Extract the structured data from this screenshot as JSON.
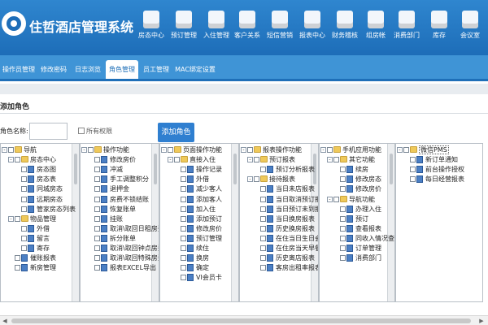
{
  "header": {
    "app_title": "住哲酒店管理系统",
    "nav": [
      {
        "label": "房态中心",
        "icon": "house-icon"
      },
      {
        "label": "预订管理",
        "icon": "booking-calendar-icon"
      },
      {
        "label": "入住管理",
        "icon": "checkin-door-icon"
      },
      {
        "label": "客户关系",
        "icon": "customers-icon"
      },
      {
        "label": "短信营销",
        "icon": "sms-envelope-icon"
      },
      {
        "label": "报表中心",
        "icon": "report-chart-icon"
      },
      {
        "label": "财务稽核",
        "icon": "finance-audit-icon"
      },
      {
        "label": "组房帐",
        "icon": "group-ledger-icon"
      },
      {
        "label": "消费部门",
        "icon": "consumption-dept-icon"
      },
      {
        "label": "库存",
        "icon": "inventory-icon"
      },
      {
        "label": "会议室",
        "icon": "meeting-room-icon"
      }
    ]
  },
  "tabs": [
    {
      "label": "操作员管理"
    },
    {
      "label": "修改密码"
    },
    {
      "label": "日志浏览"
    },
    {
      "label": "角色管理",
      "active": true
    },
    {
      "label": "员工管理"
    },
    {
      "label": "MAC绑定设置"
    }
  ],
  "page": {
    "title": "添加角色",
    "role_name_label": "角色名称:",
    "role_name_value": "",
    "all_perms_label": "所有权限",
    "add_button": "添加角色"
  },
  "trees": [
    {
      "name": "导航",
      "nodes": [
        {
          "label": "导航",
          "lv": 0,
          "type": "folder",
          "pm": "-"
        },
        {
          "label": "房态中心",
          "lv": 1,
          "type": "folder",
          "pm": "-"
        },
        {
          "label": "房态图",
          "lv": 2,
          "type": "leaf"
        },
        {
          "label": "房态表",
          "lv": 2,
          "type": "leaf"
        },
        {
          "label": "同城房态",
          "lv": 2,
          "type": "leaf"
        },
        {
          "label": "远期房态",
          "lv": 2,
          "type": "leaf"
        },
        {
          "label": "管家房态列表",
          "lv": 2,
          "type": "leaf"
        },
        {
          "label": "物品管理",
          "lv": 1,
          "type": "folder",
          "pm": "-"
        },
        {
          "label": "外借",
          "lv": 2,
          "type": "leaf"
        },
        {
          "label": "留言",
          "lv": 2,
          "type": "leaf"
        },
        {
          "label": "寄存",
          "lv": 2,
          "type": "leaf"
        },
        {
          "label": "催账报表",
          "lv": 1,
          "type": "leaf"
        },
        {
          "label": "新房管理",
          "lv": 1,
          "type": "leaf"
        }
      ]
    },
    {
      "name": "操作功能",
      "nodes": [
        {
          "label": "操作功能",
          "lv": 0,
          "type": "folder",
          "pm": "-"
        },
        {
          "label": "修改房价",
          "lv": 1,
          "type": "leaf"
        },
        {
          "label": "冲减",
          "lv": 1,
          "type": "leaf"
        },
        {
          "label": "手工调整积分",
          "lv": 1,
          "type": "leaf"
        },
        {
          "label": "退押金",
          "lv": 1,
          "type": "leaf"
        },
        {
          "label": "房费不锁结账",
          "lv": 1,
          "type": "leaf"
        },
        {
          "label": "恢复账单",
          "lv": 1,
          "type": "leaf"
        },
        {
          "label": "挂账",
          "lv": 1,
          "type": "leaf"
        },
        {
          "label": "取消\\取回日租房费",
          "lv": 1,
          "type": "leaf"
        },
        {
          "label": "拆分账单",
          "lv": 1,
          "type": "leaf"
        },
        {
          "label": "取消\\取回钟点房费",
          "lv": 1,
          "type": "leaf"
        },
        {
          "label": "取消\\取回特殊房费",
          "lv": 1,
          "type": "leaf"
        },
        {
          "label": "报表EXCEL导出",
          "lv": 1,
          "type": "leaf"
        }
      ]
    },
    {
      "name": "页面操作功能",
      "nodes": [
        {
          "label": "页面操作功能",
          "lv": 0,
          "type": "folder",
          "pm": "-"
        },
        {
          "label": "直接入住",
          "lv": 1,
          "type": "folder",
          "pm": "-"
        },
        {
          "label": "操作记录",
          "lv": 2,
          "type": "leaf"
        },
        {
          "label": "外借",
          "lv": 2,
          "type": "leaf"
        },
        {
          "label": "减少客人",
          "lv": 2,
          "type": "leaf"
        },
        {
          "label": "添加客人",
          "lv": 2,
          "type": "leaf"
        },
        {
          "label": "加入住",
          "lv": 2,
          "type": "leaf"
        },
        {
          "label": "添加预订",
          "lv": 2,
          "type": "leaf"
        },
        {
          "label": "修改房价",
          "lv": 2,
          "type": "leaf"
        },
        {
          "label": "预订管理",
          "lv": 2,
          "type": "leaf"
        },
        {
          "label": "续住",
          "lv": 2,
          "type": "leaf"
        },
        {
          "label": "换房",
          "lv": 2,
          "type": "leaf"
        },
        {
          "label": "确定",
          "lv": 2,
          "type": "leaf"
        },
        {
          "label": "VI会员卡",
          "lv": 2,
          "type": "leaf"
        }
      ]
    },
    {
      "name": "报表操作功能",
      "nodes": [
        {
          "label": "报表操作功能",
          "lv": 0,
          "type": "folder",
          "pm": "-"
        },
        {
          "label": "预订报表",
          "lv": 1,
          "type": "folder",
          "pm": "-"
        },
        {
          "label": "预订分析报表",
          "lv": 2,
          "type": "leaf"
        },
        {
          "label": "接待报表",
          "lv": 1,
          "type": "folder",
          "pm": "-"
        },
        {
          "label": "当日未店报表",
          "lv": 2,
          "type": "leaf"
        },
        {
          "label": "当日取消预订报表",
          "lv": 2,
          "type": "leaf"
        },
        {
          "label": "当日预订未到报表",
          "lv": 2,
          "type": "leaf"
        },
        {
          "label": "当日换房报表",
          "lv": 2,
          "type": "leaf"
        },
        {
          "label": "历史换房报表",
          "lv": 2,
          "type": "leaf"
        },
        {
          "label": "在住当日生日会员",
          "lv": 2,
          "type": "leaf"
        },
        {
          "label": "在住房当天早餐报",
          "lv": 2,
          "type": "leaf"
        },
        {
          "label": "历史离店报表",
          "lv": 2,
          "type": "leaf"
        },
        {
          "label": "客房出租率报表",
          "lv": 2,
          "type": "leaf"
        }
      ]
    },
    {
      "name": "手机应用功能",
      "nodes": [
        {
          "label": "手机应用功能",
          "lv": 0,
          "type": "folder",
          "pm": "-"
        },
        {
          "label": "其它功能",
          "lv": 1,
          "type": "folder",
          "pm": "-"
        },
        {
          "label": "续房",
          "lv": 2,
          "type": "leaf"
        },
        {
          "label": "修改房态",
          "lv": 2,
          "type": "leaf"
        },
        {
          "label": "修改房价",
          "lv": 2,
          "type": "leaf"
        },
        {
          "label": "导航功能",
          "lv": 1,
          "type": "folder",
          "pm": "-"
        },
        {
          "label": "办理入住",
          "lv": 2,
          "type": "leaf"
        },
        {
          "label": "预订",
          "lv": 2,
          "type": "leaf"
        },
        {
          "label": "查看报表",
          "lv": 2,
          "type": "leaf"
        },
        {
          "label": "同收入情况查看",
          "lv": 2,
          "type": "leaf"
        },
        {
          "label": "订单管理",
          "lv": 2,
          "type": "leaf"
        },
        {
          "label": "消费部门",
          "lv": 2,
          "type": "leaf"
        }
      ]
    },
    {
      "name": "微信PMS",
      "nodes": [
        {
          "label": "微信PMS",
          "lv": 0,
          "type": "folder",
          "pm": "-",
          "selected": true
        },
        {
          "label": "新订单通知",
          "lv": 1,
          "type": "leaf"
        },
        {
          "label": "前台操作授权",
          "lv": 1,
          "type": "leaf"
        },
        {
          "label": "每日经营报表",
          "lv": 1,
          "type": "leaf"
        }
      ]
    }
  ]
}
